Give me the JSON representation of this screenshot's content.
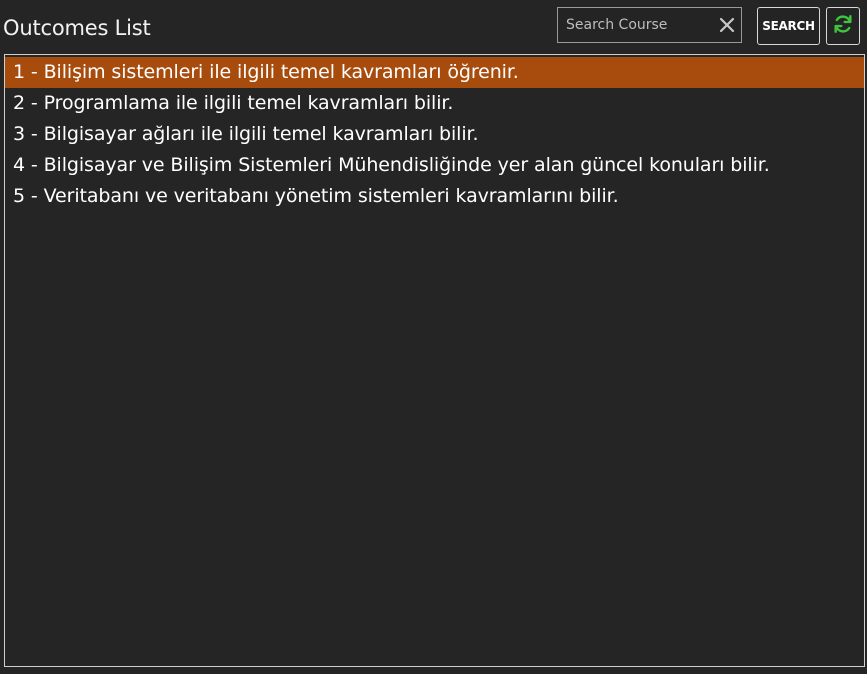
{
  "header": {
    "title": "Outcomes List"
  },
  "search": {
    "placeholder": "Search Course",
    "value": "",
    "button_label": "SEARCH",
    "clear_icon": "close-icon",
    "refresh_icon": "refresh-icon"
  },
  "colors": {
    "background": "#252525",
    "selected_row": "#a84c0e",
    "refresh_icon": "#3ec43e",
    "border": "#d0d0d0"
  },
  "outcomes": {
    "selected_index": 0,
    "items": [
      {
        "label": "1 - Bilişim sistemleri ile ilgili temel kavramları öğrenir."
      },
      {
        "label": "2 - Programlama ile ilgili temel kavramları bilir."
      },
      {
        "label": "3 - Bilgisayar ağları ile ilgili temel kavramları bilir."
      },
      {
        "label": "4 - Bilgisayar ve Bilişim Sistemleri Mühendisliğinde yer alan güncel konuları bilir."
      },
      {
        "label": "5 - Veritabanı ve veritabanı yönetim sistemleri kavramlarını bilir."
      }
    ]
  }
}
